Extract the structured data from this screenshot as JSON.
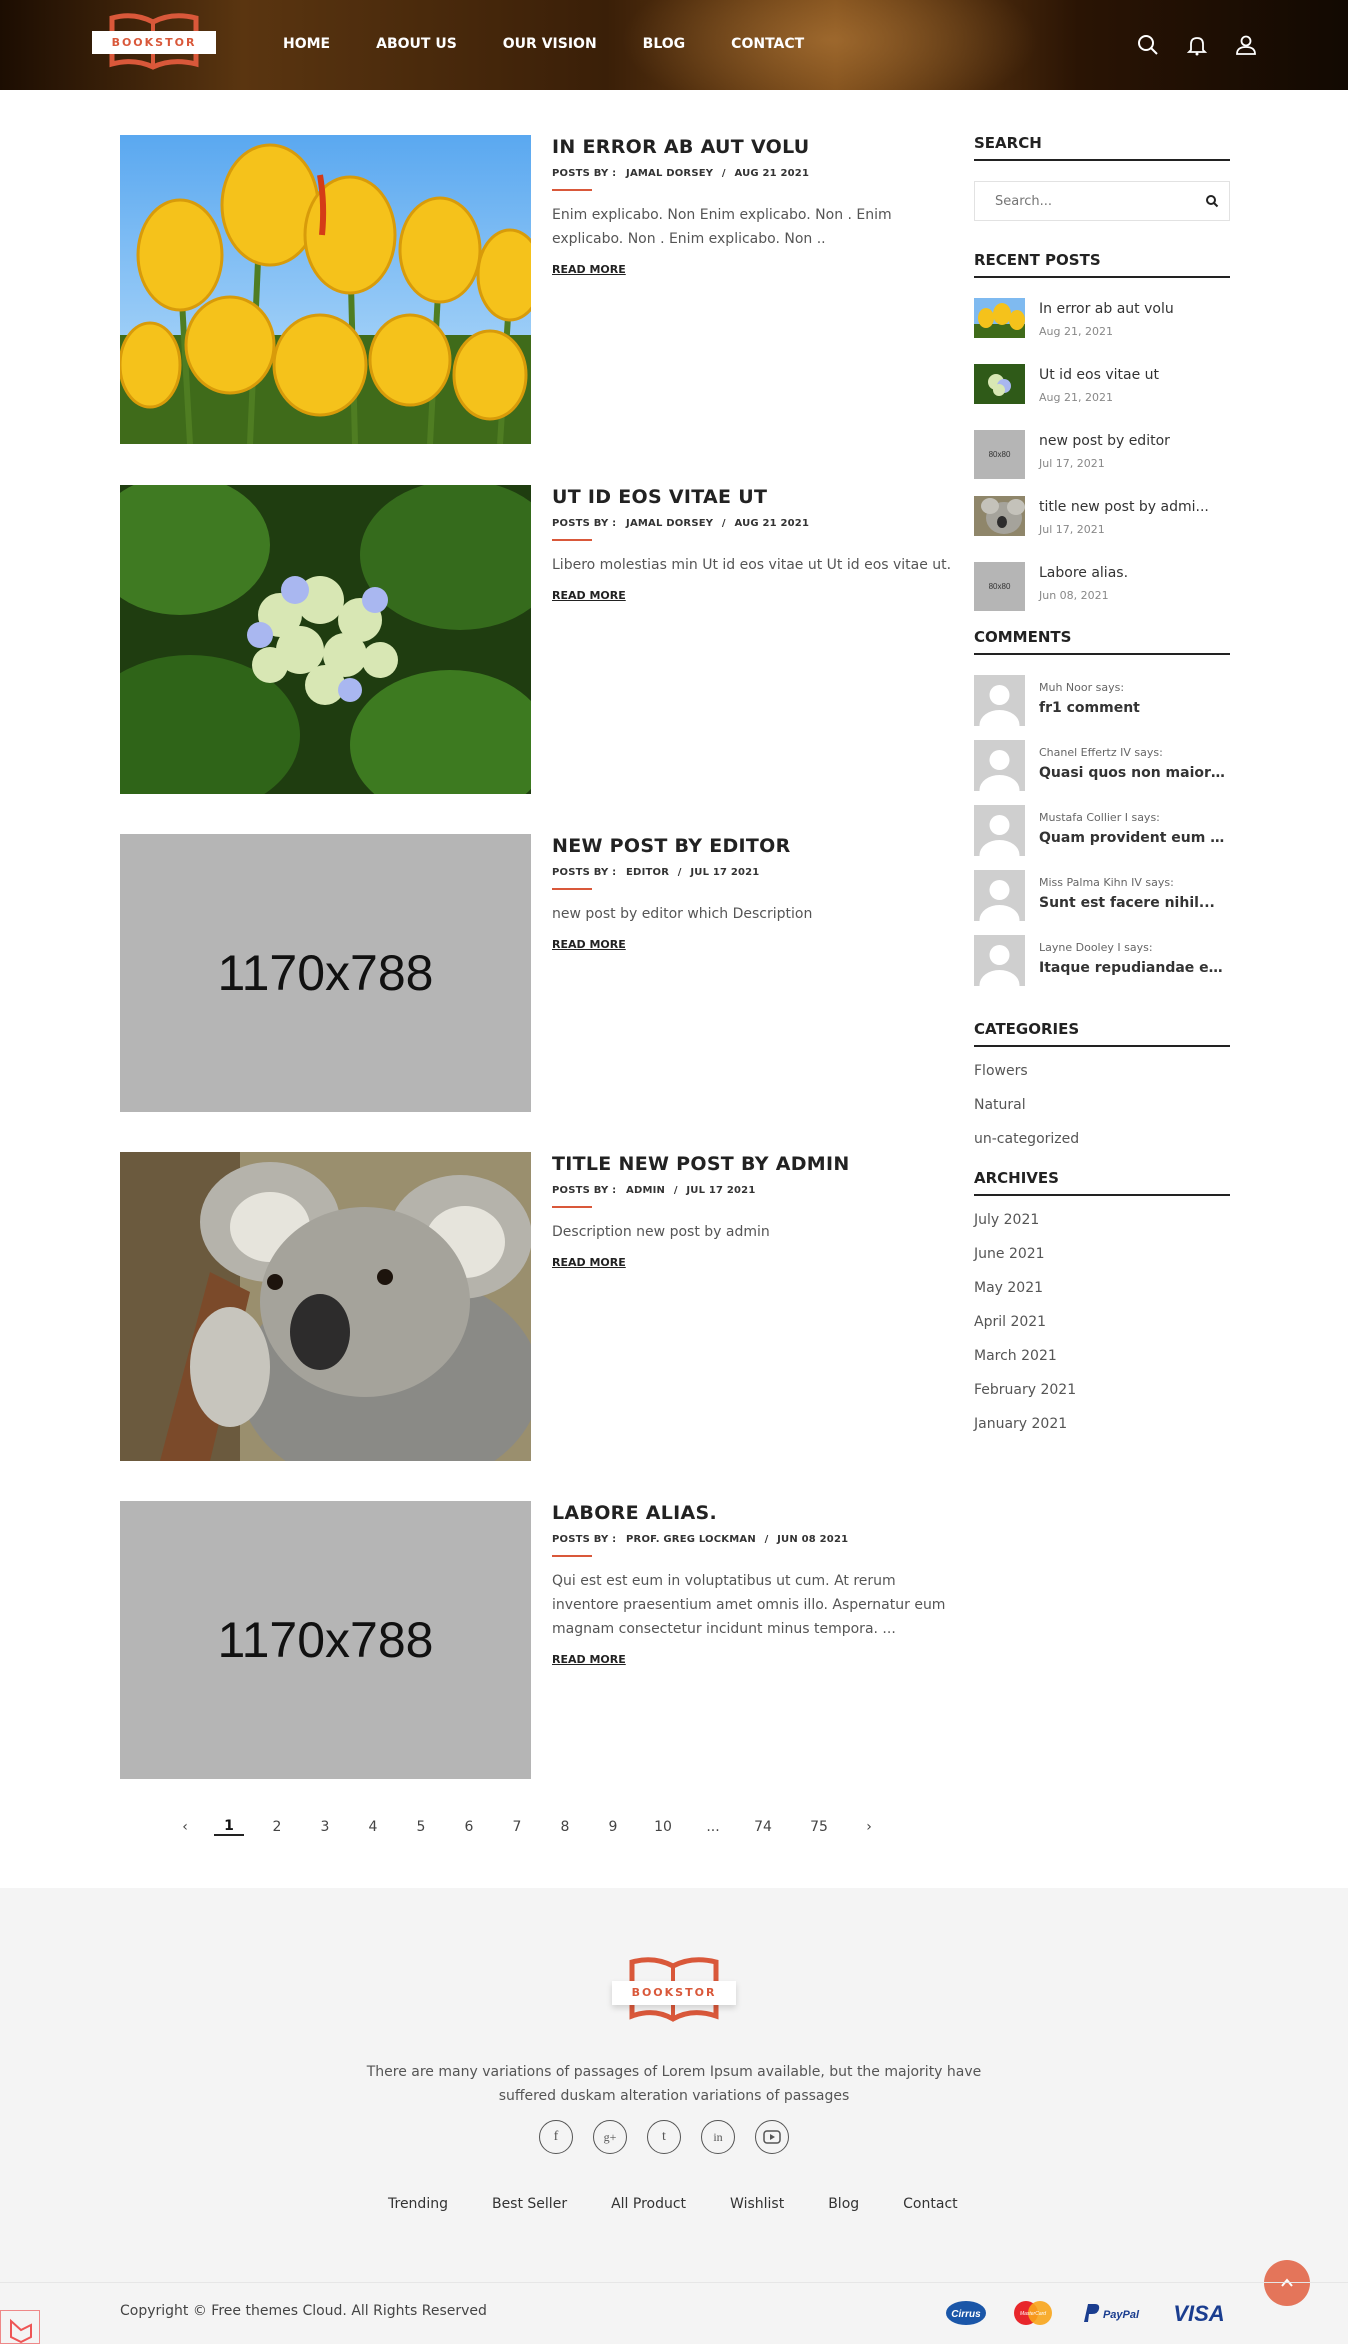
{
  "brand": {
    "name": "BOOKSTOR",
    "accent": "#d9583a"
  },
  "nav": [
    "HOME",
    "ABOUT US",
    "OUR VISION",
    "BLOG",
    "CONTACT"
  ],
  "header_icons": [
    "search-icon",
    "bell-icon",
    "user-icon"
  ],
  "posts": [
    {
      "title": "IN ERROR AB AUT VOLU",
      "by_label": "POSTS BY :",
      "author": "JAMAL DORSEY",
      "date": "AUG 21 2021",
      "excerpt": "Enim explicabo. Non Enim explicabo. Non . Enim explicabo. Non . Enim explicabo. Non ..",
      "read_more": "READ MORE",
      "image": "yellow-tulips-photo"
    },
    {
      "title": "UT ID EOS VITAE UT",
      "by_label": "POSTS BY :",
      "author": "JAMAL DORSEY",
      "date": "AUG 21 2021",
      "excerpt": "Libero molestias min Ut id eos vitae ut Ut id eos vitae ut.",
      "read_more": "READ MORE",
      "image": "hydrangea-photo"
    },
    {
      "title": "NEW POST BY EDITOR",
      "by_label": "POSTS BY :",
      "author": "EDITOR",
      "date": "JUL 17 2021",
      "excerpt": "new post by editor which Description",
      "read_more": "READ MORE",
      "placeholder": "1170x788"
    },
    {
      "title": "TITLE NEW POST BY ADMIN",
      "by_label": "POSTS BY :",
      "author": "ADMIN",
      "date": "JUL 17 2021",
      "excerpt": "Description new post by admin",
      "read_more": "READ MORE",
      "image": "koala-photo"
    },
    {
      "title": "LABORE ALIAS.",
      "by_label": "POSTS BY :",
      "author": "PROF. GREG LOCKMAN",
      "date": "JUN 08 2021",
      "excerpt": "Qui est est eum in voluptatibus ut cum. At rerum inventore praesentium amet omnis illo. Aspernatur eum magnam consectetur incidunt minus tempora. ...",
      "read_more": "READ MORE",
      "placeholder": "1170x788"
    }
  ],
  "sidebar": {
    "search": {
      "title": "SEARCH",
      "placeholder": "Search..."
    },
    "recent": {
      "title": "RECENT POSTS",
      "items": [
        {
          "title": "In error ab aut volu",
          "date": "Aug 21, 2021"
        },
        {
          "title": "Ut id eos vitae ut",
          "date": "Aug 21, 2021"
        },
        {
          "title": "new post by editor",
          "date": "Jul 17, 2021",
          "placeholder": "80x80"
        },
        {
          "title": "title new post by admi...",
          "date": "Jul 17, 2021"
        },
        {
          "title": "Labore alias.",
          "date": "Jun 08, 2021",
          "placeholder": "80x80"
        }
      ]
    },
    "comments": {
      "title": "COMMENTS",
      "items": [
        {
          "who": "Muh Noor says:",
          "text": "fr1 comment"
        },
        {
          "who": "Chanel Effertz IV says:",
          "text": "Quasi quos non maiores..."
        },
        {
          "who": "Mustafa Collier I says:",
          "text": "Quam provident eum ill..."
        },
        {
          "who": "Miss Palma Kihn IV says:",
          "text": "Sunt est facere nihil..."
        },
        {
          "who": "Layne Dooley I says:",
          "text": "Itaque repudiandae eum..."
        }
      ]
    },
    "categories": {
      "title": "CATEGORIES",
      "items": [
        "Flowers",
        "Natural",
        "un-categorized"
      ]
    },
    "archives": {
      "title": "ARCHIVES",
      "items": [
        "July 2021",
        "June 2021",
        "May 2021",
        "April 2021",
        "March 2021",
        "February 2021",
        "January 2021"
      ]
    }
  },
  "pagination": {
    "prev": "‹",
    "pages": [
      "1",
      "2",
      "3",
      "4",
      "5",
      "6",
      "7",
      "8",
      "9",
      "10",
      "...",
      "74",
      "75"
    ],
    "next": "›",
    "current": "1"
  },
  "footer": {
    "description": "There are many variations of passages of Lorem Ipsum available, but the majority have suffered duskam alteration variations of passages",
    "social": [
      "facebook-icon",
      "google-plus-icon",
      "tumblr-icon",
      "linkedin-icon",
      "youtube-icon"
    ],
    "links": [
      "Trending",
      "Best Seller",
      "All Product",
      "Wishlist",
      "Blog",
      "Contact"
    ],
    "copyright": "Copyright © Free themes Cloud. All Rights Reserved",
    "payments": [
      "Cirrus",
      "MasterCard",
      "PayPal",
      "VISA"
    ]
  }
}
